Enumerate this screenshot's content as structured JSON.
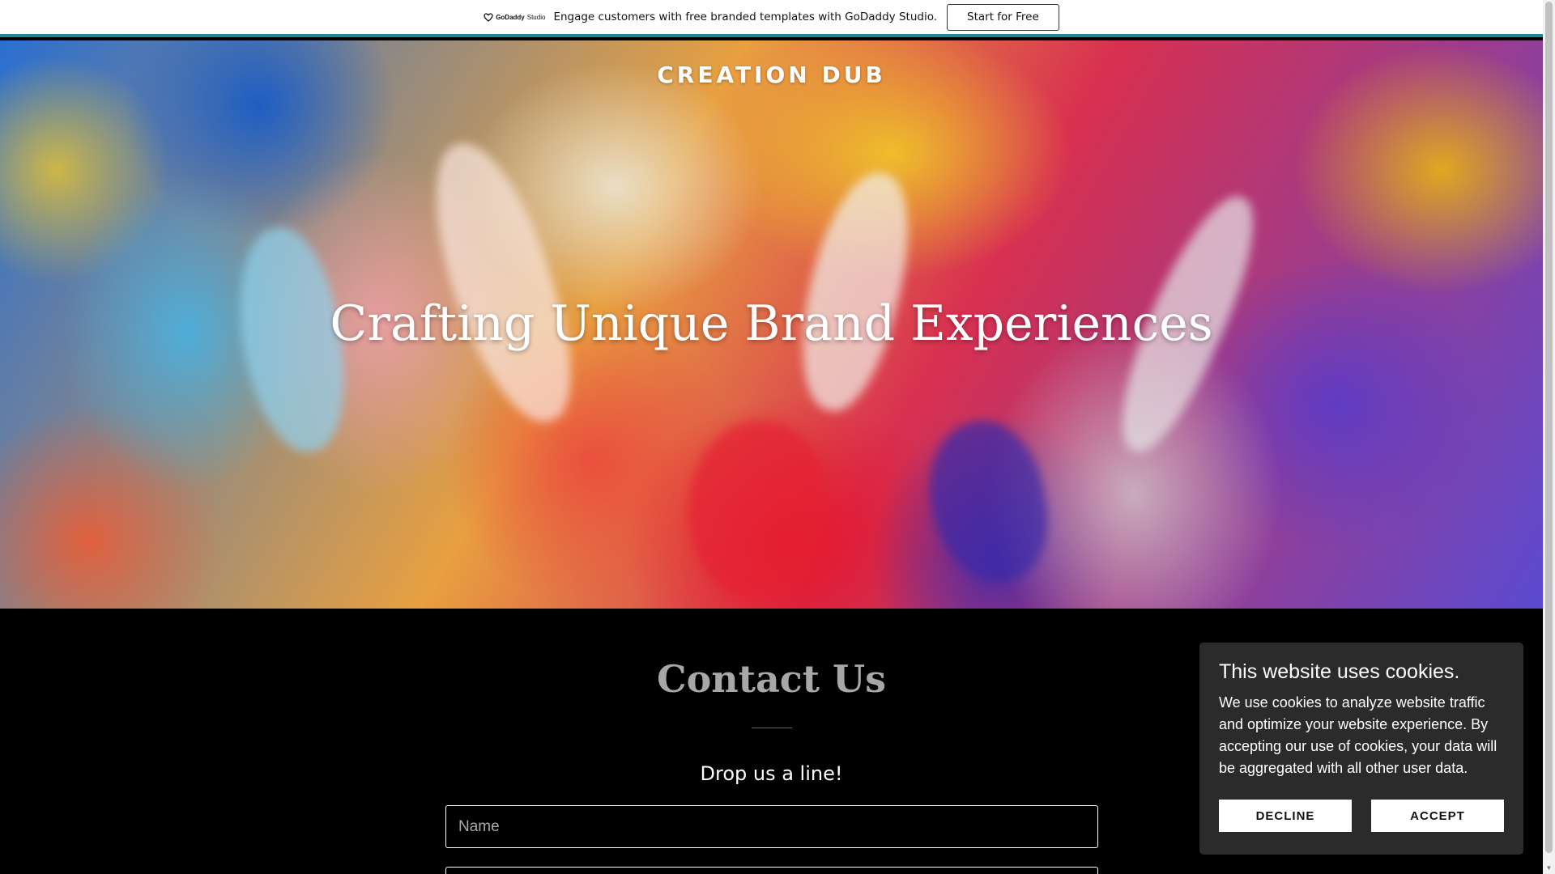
{
  "promo": {
    "logo_brand": "GoDaddy",
    "logo_product": "Studio",
    "message": "Engage customers with free branded templates with GoDaddy Studio.",
    "cta": "Start for Free"
  },
  "hero": {
    "site_title": "CREATION DUB",
    "heading": "Crafting Unique Brand Experiences"
  },
  "contact": {
    "title": "Contact Us",
    "subtitle": "Drop us a line!",
    "name_placeholder": "Name"
  },
  "cookie": {
    "title": "This website uses cookies.",
    "body": "We use cookies to analyze website traffic and optimize your website experience. By accepting our use of cookies, your data will be aggregated with all other user data.",
    "decline": "DECLINE",
    "accept": "ACCEPT"
  },
  "colors": {
    "promo_accent": "#1b8a93",
    "page_background": "#000000",
    "cookie_background": "#2b2b2b"
  }
}
